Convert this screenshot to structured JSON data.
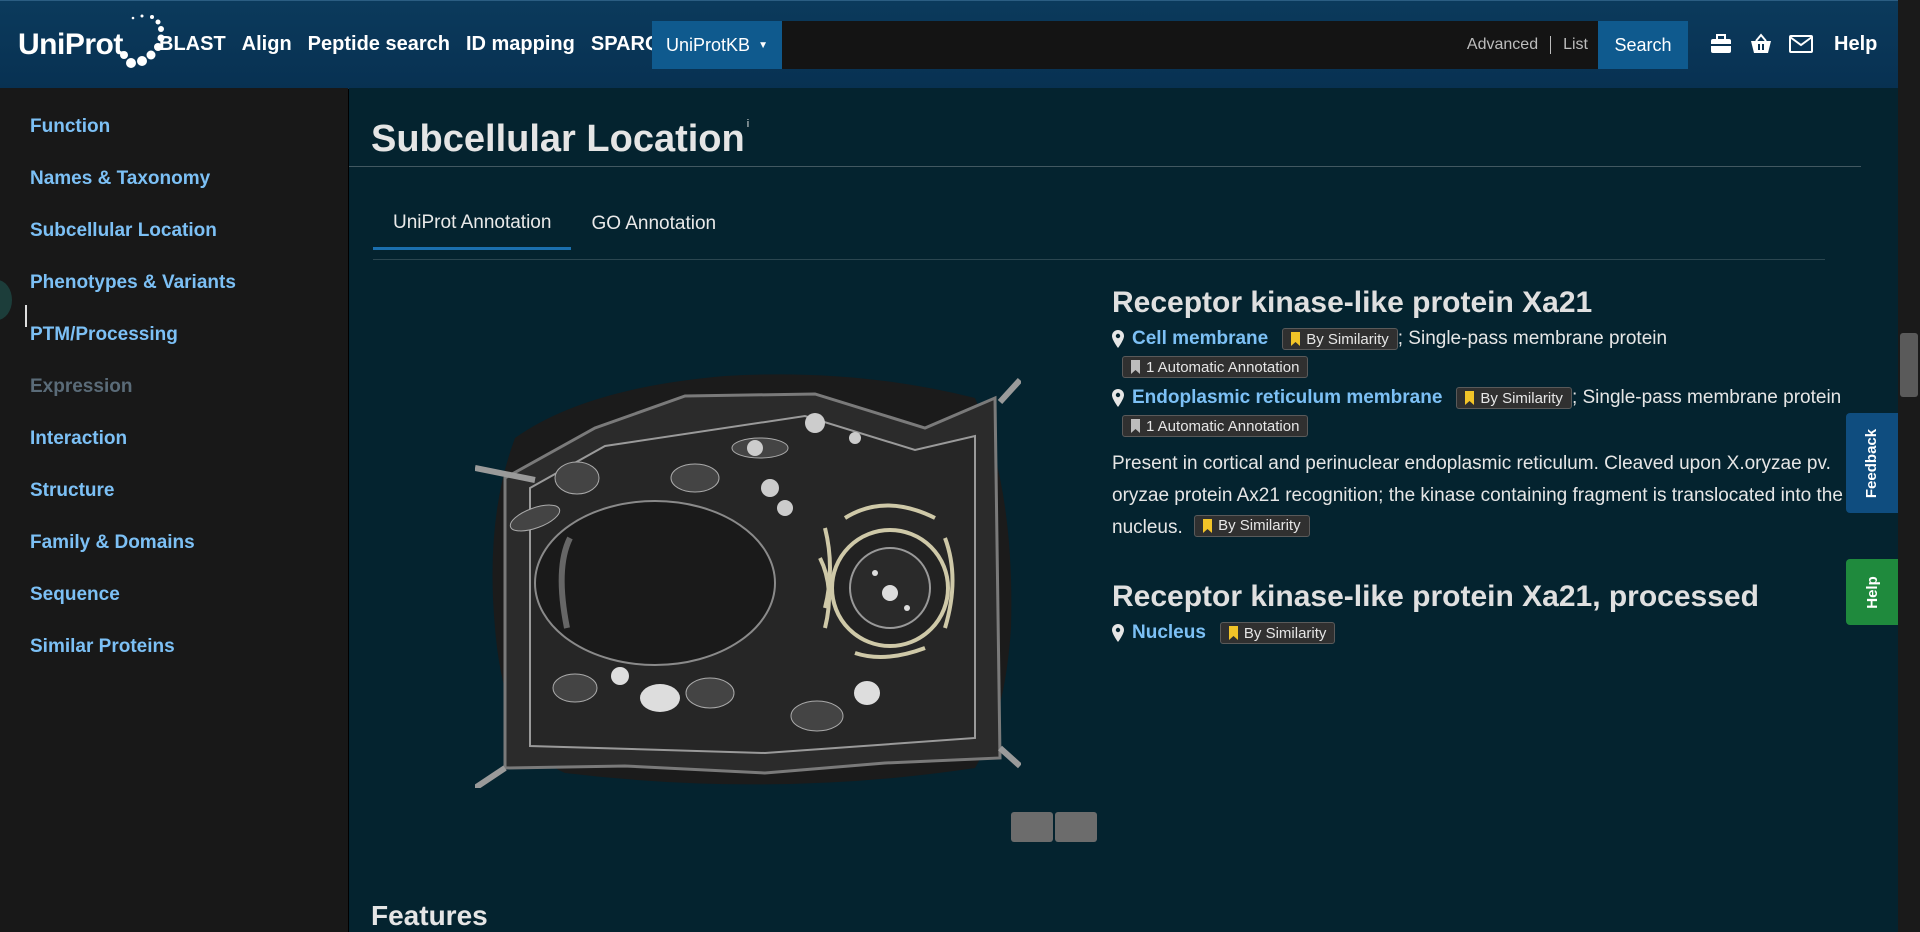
{
  "header": {
    "logo_text": "UniProt",
    "nav": [
      "BLAST",
      "Align",
      "Peptide search",
      "ID mapping",
      "SPARQL"
    ],
    "search": {
      "database": "UniProtKB",
      "placeholder": "",
      "advanced": "Advanced",
      "list": "List",
      "button": "Search"
    },
    "help": "Help"
  },
  "sidebar": {
    "items": [
      {
        "label": "Function"
      },
      {
        "label": "Names & Taxonomy"
      },
      {
        "label": "Subcellular Location"
      },
      {
        "label": "Phenotypes & Variants"
      },
      {
        "label": "PTM/Processing"
      },
      {
        "label": "Expression"
      },
      {
        "label": "Interaction"
      },
      {
        "label": "Structure"
      },
      {
        "label": "Family & Domains"
      },
      {
        "label": "Sequence"
      },
      {
        "label": "Similar Proteins"
      }
    ]
  },
  "main": {
    "title": "Subcellular Location",
    "title_info": "i",
    "tabs": [
      "UniProt Annotation",
      "GO Annotation"
    ],
    "groups": [
      {
        "heading": "Receptor kinase-like protein Xa21",
        "locations": [
          {
            "name": "Cell membrane",
            "evidence": "By Similarity",
            "topology": "; Single-pass membrane protein",
            "auto": "1 Automatic Annotation"
          },
          {
            "name": "Endoplasmic reticulum membrane",
            "evidence": "By Similarity",
            "topology": "; Single-pass membrane protein",
            "auto": "1 Automatic Annotation"
          }
        ],
        "note": "Present in cortical and perinuclear endoplasmic reticulum. Cleaved upon X.oryzae pv. oryzae protein Ax21 recognition; the kinase containing fragment is translocated into the nucleus.",
        "note_evidence": "By Similarity"
      },
      {
        "heading": "Receptor kinase-like protein Xa21, processed",
        "locations": [
          {
            "name": "Nucleus",
            "evidence": "By Similarity"
          }
        ]
      }
    ],
    "next_section": "Features"
  },
  "side_tabs": {
    "feedback": "Feedback",
    "help": "Help"
  },
  "colors": {
    "link": "#7cc0f5",
    "header": "#083152",
    "main_bg": "#04232f",
    "sidebar_bg": "#181818"
  }
}
